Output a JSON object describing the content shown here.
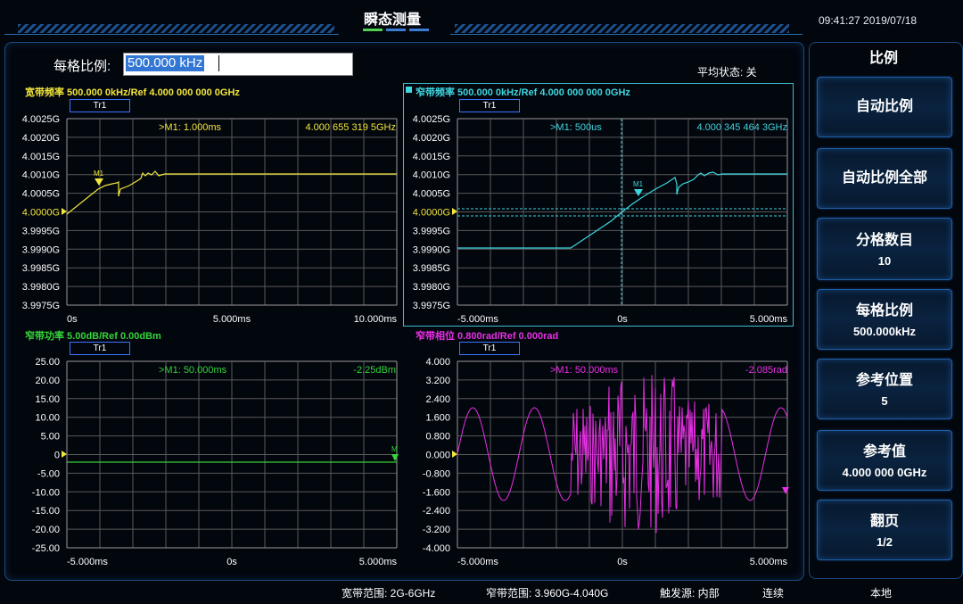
{
  "header": {
    "title": "瞬态测量",
    "datetime": "09:41:27  2019/07/18"
  },
  "scale_input": {
    "label": "每格比例:",
    "value": "500.000 kHz"
  },
  "avg_status": "平均状态: 关",
  "panels": {
    "wideband_freq": {
      "header": "宽带频率 500.000 0kHz/Ref 4.000 000 000 0GHz",
      "trace": "Tr1",
      "marker": ">M1: 1.000ms",
      "marker_value": "4.000 655 319 5GHz",
      "marker_name": "M1",
      "color": "#f2e53c",
      "y_ticks": [
        "4.0025G",
        "4.0020G",
        "4.0015G",
        "4.0010G",
        "4.0005G",
        "4.0000G",
        "3.9995G",
        "3.9990G",
        "3.9985G",
        "3.9980G",
        "3.9975G"
      ],
      "x_ticks": [
        "0s",
        "5.000ms",
        "10.000ms"
      ]
    },
    "narrowband_freq": {
      "header": "窄带频率 500.000 0kHz/Ref 4.000 000 000 0GHz",
      "trace": "Tr1",
      "marker": ">M1: 500us",
      "marker_value": "4.000 345 464 3GHz",
      "marker_name": "M1",
      "color": "#3fd6e0",
      "y_ticks": [
        "4.0025G",
        "4.0020G",
        "4.0015G",
        "4.0010G",
        "4.0005G",
        "4.0000G",
        "3.9995G",
        "3.9990G",
        "3.9985G",
        "3.9980G",
        "3.9975G"
      ],
      "x_ticks": [
        "-5.000ms",
        "0s",
        "5.000ms"
      ]
    },
    "narrowband_power": {
      "header": "窄带功率 5.00dB/Ref 0.00dBm",
      "trace": "Tr1",
      "marker": ">M1: 50.000ms",
      "marker_value": "-2.25dBm",
      "marker_name": "M",
      "color": "#35d43a",
      "y_ticks": [
        "25.00",
        "20.00",
        "15.00",
        "10.00",
        "5.00",
        "0",
        "-5.00",
        "-10.00",
        "-15.00",
        "-20.00",
        "-25.00"
      ],
      "x_ticks": [
        "-5.000ms",
        "0s",
        "5.000ms"
      ]
    },
    "narrowband_phase": {
      "header": "窄带相位 0.800rad/Ref 0.000rad",
      "trace": "Tr1",
      "marker": ">M1: 50.000ms",
      "marker_value": "-2.085rad",
      "color": "#ea2fe6",
      "y_ticks": [
        "4.000",
        "3.200",
        "2.400",
        "1.600",
        "0.800",
        "0.000",
        "-0.800",
        "-1.600",
        "-2.400",
        "-3.200",
        "-4.000"
      ],
      "x_ticks": [
        "-5.000ms",
        "0s",
        "5.000ms"
      ]
    }
  },
  "side_menu": {
    "title": "比例",
    "auto_scale": "自动比例",
    "auto_scale_all": "自动比例全部",
    "divisions": {
      "label": "分格数目",
      "value": "10"
    },
    "per_div": {
      "label": "每格比例",
      "value": "500.000kHz"
    },
    "ref_position": {
      "label": "参考位置",
      "value": "5"
    },
    "ref_value": {
      "label": "参考值",
      "value": "4.000 000 0GHz"
    },
    "page": {
      "label": "翻页",
      "value": "1/2"
    }
  },
  "status_bar": {
    "wideband_range": "宽带范围: 2G-6GHz",
    "narrowband_range": "窄带范围: 3.960G-4.040G",
    "trigger_source": "触发源: 内部",
    "mode": "连续",
    "local": "本地"
  }
}
